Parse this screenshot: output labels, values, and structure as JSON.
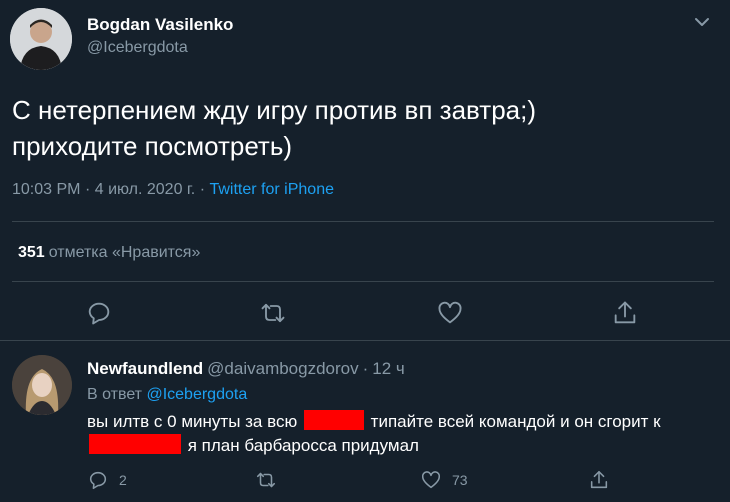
{
  "tweet": {
    "author_name": "Bogdan Vasilenko",
    "author_handle": "@Icebergdota",
    "text_line1": "С нетерпением жду игру против вп завтра;)",
    "text_line2": "приходите посмотреть)",
    "time": "10:03 PM",
    "date": "4 июл. 2020 г.",
    "source": "Twitter for iPhone",
    "likes_count": "351",
    "likes_label": "отметка «Нравится»",
    "icons": [
      "reply-icon",
      "retweet-icon",
      "like-icon",
      "share-icon"
    ]
  },
  "reply": {
    "author_name": "Newfaundlend",
    "author_handle": "@daivambogzdorov",
    "age": "12 ч",
    "reply_prefix": "В ответ",
    "reply_mention": "@Icebergdota",
    "text_part1": "вы илтв с 0 минуты за всю",
    "text_part2": "типайте всей командой и он сгорит к",
    "text_part3": "я план барбаросса придумал",
    "reply_count": "2",
    "like_count": "73",
    "icons": [
      "reply-icon",
      "retweet-icon",
      "like-icon",
      "share-icon"
    ]
  },
  "colors": {
    "background": "#15202b",
    "divider": "#38444d",
    "secondary_text": "#8899a6",
    "link": "#1da1f2",
    "redaction": "#ff0000"
  }
}
